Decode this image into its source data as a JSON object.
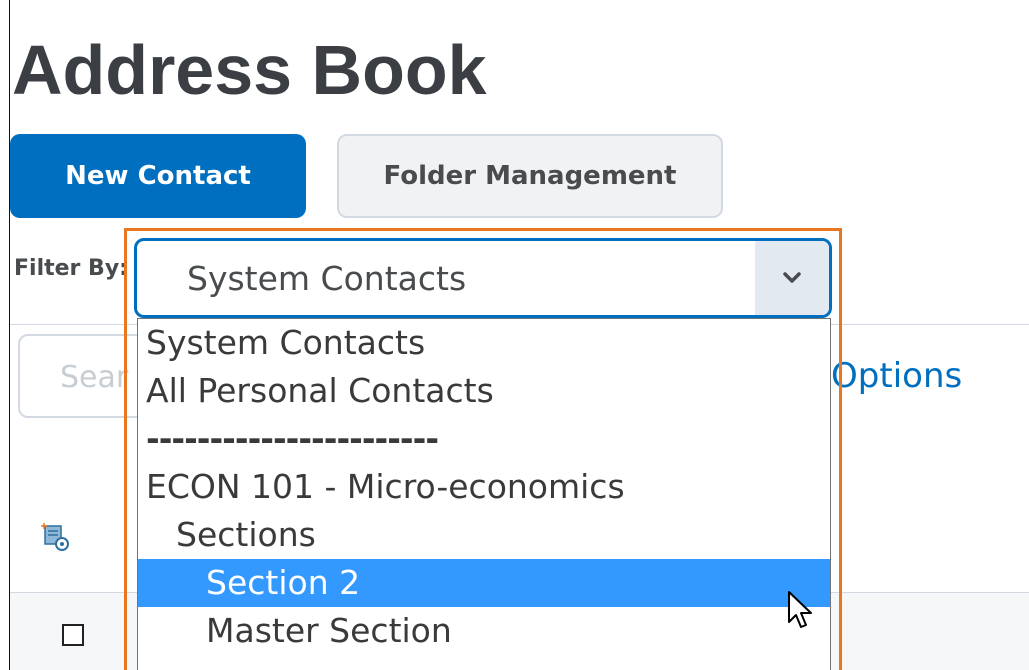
{
  "page": {
    "title": "Address Book"
  },
  "toolbar": {
    "new_contact_label": "New Contact",
    "folder_management_label": "Folder Management"
  },
  "filter": {
    "label": "Filter By:",
    "selected_value": "System Contacts",
    "options": [
      {
        "label": "System Contacts",
        "selected": false
      },
      {
        "label": "All Personal Contacts",
        "selected": false
      },
      {
        "label": "-----------------------",
        "selected": false
      },
      {
        "label": "ECON 101 - Micro-economics",
        "selected": false
      },
      {
        "label": "Sections",
        "selected": false
      },
      {
        "label": "Section 2",
        "selected": true
      },
      {
        "label": "Master Section",
        "selected": false
      }
    ]
  },
  "search": {
    "placeholder": "Sear",
    "options_label": "ch Options"
  },
  "colors": {
    "primary": "#006fbf",
    "highlight_outline": "#e87722",
    "selected_option": "#3399ff"
  },
  "icons": {
    "dropdown": "chevron-down-icon",
    "contacts": "add-contact-icon",
    "cursor": "mouse-pointer-icon"
  }
}
